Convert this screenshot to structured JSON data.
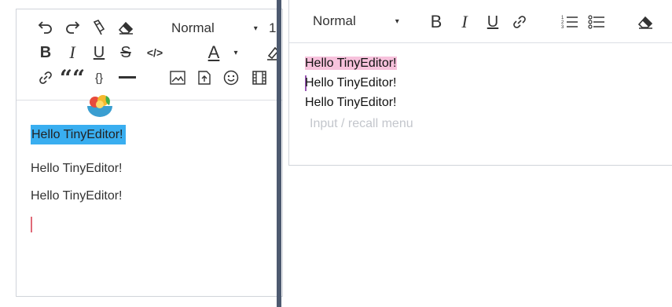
{
  "left_editor": {
    "toolbar": {
      "header_select": "Normal",
      "size_select_partial": "1",
      "buttons": {
        "undo": "undo-icon",
        "redo": "redo-icon",
        "clean_format": "format-painter-icon",
        "clear": "eraser-icon",
        "bold": "B",
        "italic": "I",
        "underline": "U",
        "strike": "S",
        "code": "</>",
        "color": "A",
        "highlight": "highlighter-icon",
        "link": "link-icon",
        "blockquote": "““",
        "code_block": "{}",
        "divider": "horizontal-rule-icon",
        "image": "image-icon",
        "upload": "upload-icon",
        "emoji": "emoji-icon",
        "video": "film-icon"
      }
    },
    "content": {
      "paragraphs": [
        "Hello TinyEditor!",
        "Hello TinyEditor!",
        "Hello TinyEditor!"
      ]
    }
  },
  "right_editor": {
    "toolbar": {
      "header_select": "Normal",
      "bold": "B",
      "italic": "I",
      "underline": "U"
    },
    "content": {
      "paragraphs": [
        "Hello TinyEditor!",
        "Hello TinyEditor!",
        "Hello TinyEditor!"
      ],
      "placeholder": "Input / recall menu"
    }
  },
  "colors": {
    "selection_blue": "#39aef0",
    "highlight_pink": "#f7c2dc",
    "divider": "#4d5a70",
    "border": "#d0d4da"
  }
}
